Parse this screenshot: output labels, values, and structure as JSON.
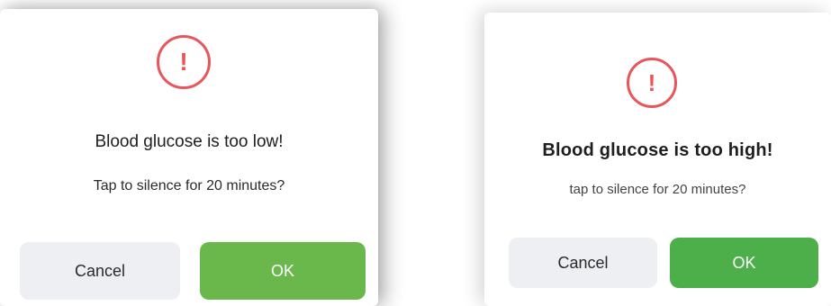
{
  "dialogs": [
    {
      "icon": "exclamation-alert-icon",
      "icon_glyph": "!",
      "title": "Blood glucose is too low!",
      "message": "Tap to silence for 20 minutes?",
      "cancel_label": "Cancel",
      "ok_label": "OK"
    },
    {
      "icon": "exclamation-alert-icon",
      "icon_glyph": "!",
      "title": "Blood glucose is too high!",
      "message": "tap to silence for 20 minutes?",
      "cancel_label": "Cancel",
      "ok_label": "OK"
    }
  ],
  "colors": {
    "alert_red": "#e8555a",
    "ok_green_left": "#6ab84b",
    "ok_green_right": "#4caf4a",
    "cancel_gray": "#eeeff2"
  }
}
